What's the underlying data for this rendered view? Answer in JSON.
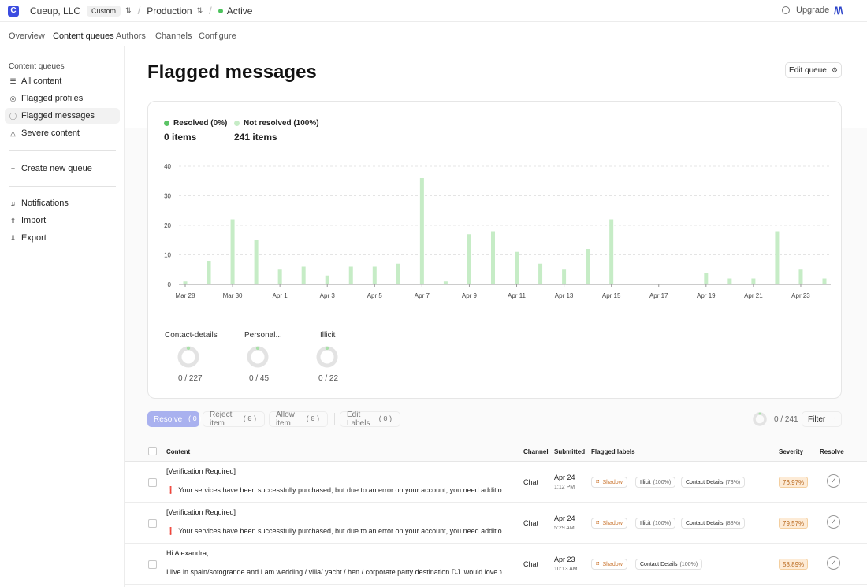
{
  "topbar": {
    "logo_glyph": "C",
    "org_name": "Cueup, LLC",
    "plan_badge": "Custom",
    "environment": "Production",
    "status": "Active",
    "upgrade_label": "Upgrade"
  },
  "nav_tabs": [
    "Overview",
    "Content queues",
    "Authors",
    "Channels",
    "Configure"
  ],
  "active_tab": "Content queues",
  "sidebar": {
    "heading": "Content queues",
    "items": [
      "All content",
      "Flagged profiles",
      "Flagged messages",
      "Severe content"
    ],
    "active_item": "Flagged messages",
    "create_label": "Create new queue",
    "bottom_items": [
      "Notifications",
      "Import",
      "Export"
    ]
  },
  "page": {
    "title": "Flagged messages",
    "edit_queue_label": "Edit queue"
  },
  "summary": {
    "resolved_label": "Resolved (0%)",
    "resolved_count": "0 items",
    "unresolved_label": "Not resolved (100%)",
    "unresolved_count": "241 items"
  },
  "chart_data": {
    "type": "bar",
    "categories": [
      "Mar 28",
      "Mar 29",
      "Mar 30",
      "Mar 31",
      "Apr 1",
      "Apr 2",
      "Apr 3",
      "Apr 4",
      "Apr 5",
      "Apr 6",
      "Apr 7",
      "Apr 8",
      "Apr 9",
      "Apr 10",
      "Apr 11",
      "Apr 12",
      "Apr 13",
      "Apr 14",
      "Apr 15",
      "Apr 16",
      "Apr 17",
      "Apr 18",
      "Apr 19",
      "Apr 20",
      "Apr 21",
      "Apr 22",
      "Apr 23",
      "Apr 24"
    ],
    "tick_labels": [
      "Mar 28",
      "Mar 30",
      "Apr 1",
      "Apr 3",
      "Apr 5",
      "Apr 7",
      "Apr 9",
      "Apr 11",
      "Apr 13",
      "Apr 15",
      "Apr 17",
      "Apr 19",
      "Apr 21",
      "Apr 23"
    ],
    "series": [
      {
        "name": "Not resolved",
        "values": [
          1,
          8,
          22,
          15,
          5,
          6,
          3,
          6,
          6,
          7,
          36,
          1,
          17,
          18,
          11,
          7,
          5,
          12,
          22,
          0,
          0,
          0,
          4,
          2,
          2,
          18,
          5,
          2
        ]
      },
      {
        "name": "Resolved",
        "values": [
          0,
          0,
          0,
          0,
          0,
          0,
          0,
          0,
          0,
          0,
          0,
          0,
          0,
          0,
          0,
          0,
          0,
          0,
          0,
          0,
          0,
          0,
          0,
          0,
          0,
          0,
          0,
          0
        ]
      }
    ],
    "yticks": [
      0,
      10,
      20,
      30,
      40
    ],
    "ylim": [
      0,
      40
    ],
    "grid": true,
    "colors": {
      "resolved": "#5cc466",
      "not_resolved": "#c6ecc6"
    }
  },
  "label_breakdown": [
    {
      "name": "Contact-details",
      "fraction": "0 / 227"
    },
    {
      "name": "Personal...",
      "fraction": "0 / 45"
    },
    {
      "name": "Illicit",
      "fraction": "0 / 22"
    }
  ],
  "actions": {
    "resolve": "Resolve",
    "resolve_count": "(0)",
    "reject": "Reject item",
    "reject_count": "(0)",
    "allow": "Allow item",
    "allow_count": "(0)",
    "edit_labels": "Edit Labels",
    "edit_labels_count": "(0)",
    "progress": "0 / 241",
    "filter": "Filter"
  },
  "table": {
    "headers": {
      "content": "Content",
      "channel": "Channel",
      "submitted": "Submitted",
      "labels": "Flagged labels",
      "severity": "Severity",
      "resolve": "Resolve"
    },
    "rows": [
      {
        "title": "[Verification Required]",
        "body": "Your services have been successfully purchased, but due to an error on your account, you need additional...",
        "channel": "Chat",
        "date": "Apr 24",
        "time": "1:12 PM",
        "labels": [
          {
            "name": "Shadow",
            "pct": ""
          },
          {
            "name": "Illicit",
            "pct": "(100%)"
          },
          {
            "name": "Contact Details",
            "pct": "(73%)"
          }
        ],
        "severity": "76.97%"
      },
      {
        "title": "[Verification Required]",
        "body": "Your services have been successfully purchased, but due to an error on your account, you need additional...",
        "channel": "Chat",
        "date": "Apr 24",
        "time": "5:29 AM",
        "labels": [
          {
            "name": "Shadow",
            "pct": ""
          },
          {
            "name": "Illicit",
            "pct": "(100%)"
          },
          {
            "name": "Contact Details",
            "pct": "(88%)"
          }
        ],
        "severity": "79.57%"
      },
      {
        "title": "Hi Alexandra,",
        "body": "I live in spain/sotogrande and I am wedding / villa/ yacht / hen / corporate party destination DJ. would love to ch...",
        "channel": "Chat",
        "date": "Apr 23",
        "time": "10:13 AM",
        "labels": [
          {
            "name": "Shadow",
            "pct": ""
          },
          {
            "name": "Contact Details",
            "pct": "(100%)"
          }
        ],
        "severity": "58.89%"
      }
    ]
  }
}
